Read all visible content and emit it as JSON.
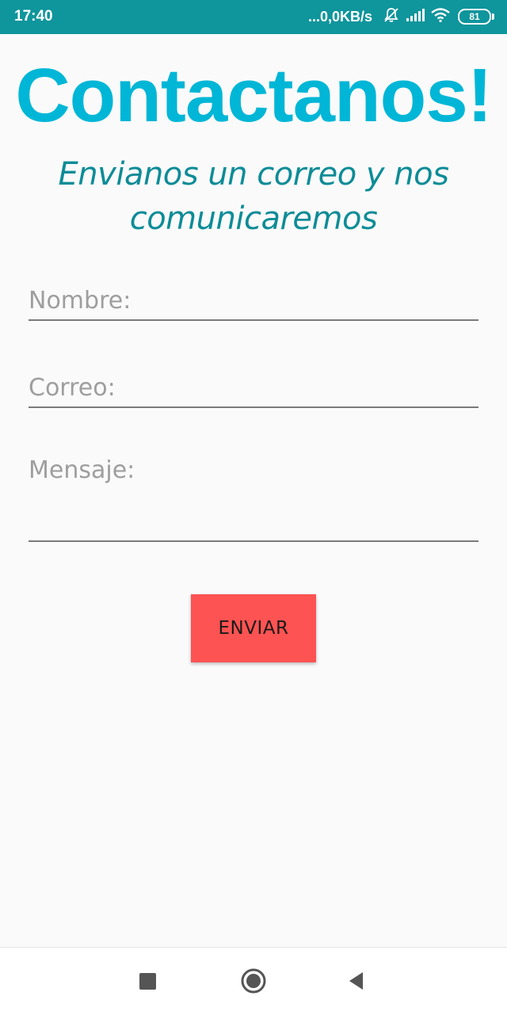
{
  "status_bar": {
    "time": "17:40",
    "net_speed": "...0,0KB/s",
    "battery": "81",
    "icons": [
      "bell-off-icon",
      "signal-icon",
      "wifi-icon",
      "battery-icon"
    ]
  },
  "header": {
    "title": "Contactanos!",
    "subtitle": "Envianos un correo y nos comunicaremos"
  },
  "form": {
    "nombre_placeholder": "Nombre:",
    "correo_placeholder": "Correo:",
    "mensaje_placeholder": "Mensaje:",
    "submit_label": "ENVIAR"
  },
  "nav": {
    "icons": [
      "recent-apps-icon",
      "home-icon",
      "back-icon"
    ]
  },
  "colors": {
    "status_bar": "#0f959c",
    "title": "#00b6d6",
    "subtitle": "#0d8c97",
    "button": "#fd5352",
    "background": "#fafafa"
  }
}
